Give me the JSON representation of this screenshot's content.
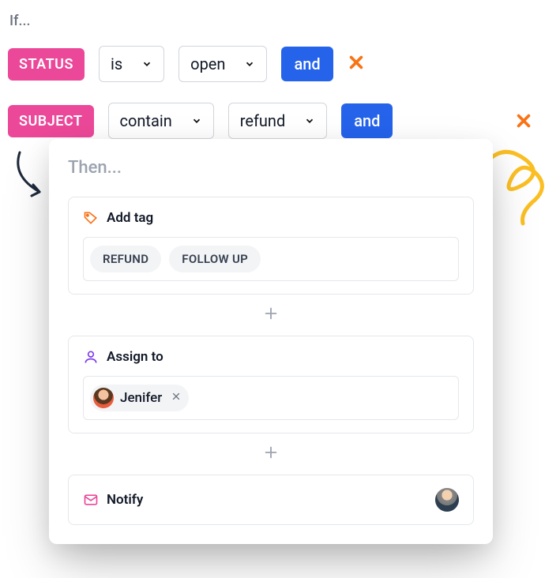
{
  "header": {
    "if_label": "If..."
  },
  "conditions": [
    {
      "field": "STATUS",
      "operator": "is",
      "value": "open",
      "connector": "and"
    },
    {
      "field": "SUBJECT",
      "operator": "contain",
      "value": "refund",
      "connector": "and"
    }
  ],
  "then": {
    "label": "Then...",
    "actions": {
      "add_tag": {
        "title": "Add tag",
        "tags": [
          "REFUND",
          "FOLLOW UP"
        ]
      },
      "assign": {
        "title": "Assign to",
        "assignee": "Jenifer"
      },
      "notify": {
        "title": "Notify"
      }
    }
  },
  "decor": {
    "at": "@"
  }
}
